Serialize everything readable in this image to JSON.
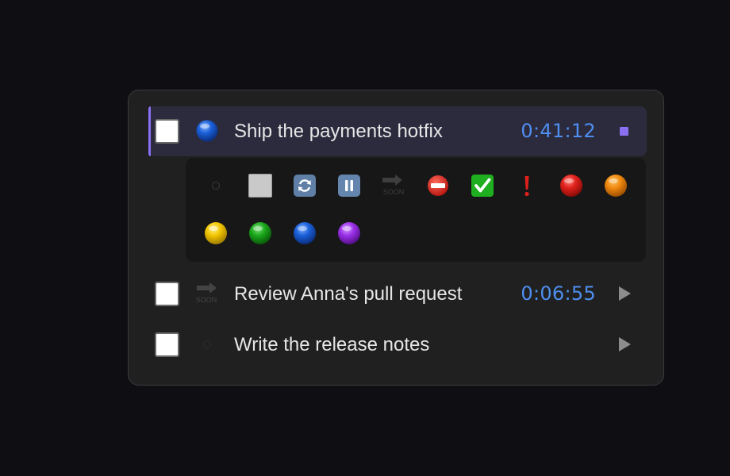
{
  "tasks": [
    {
      "title": "Ship the payments hotfix",
      "timer": "0:41:12",
      "status_icon": "blue-ball-icon",
      "action": "stop",
      "active": true,
      "checked": false
    },
    {
      "title": "Review Anna's pull request",
      "timer": "0:06:55",
      "status_icon": "soon-arrow-icon",
      "action": "play",
      "active": false,
      "checked": false
    },
    {
      "title": "Write the release notes",
      "timer": "",
      "status_icon": "empty-circle-icon",
      "action": "play",
      "active": false,
      "checked": false
    }
  ],
  "soon_label": "SOON",
  "status_picker": {
    "options": [
      "empty-circle-icon",
      "white-square-icon",
      "repeat-icon",
      "pause-icon",
      "soon-arrow-icon",
      "no-entry-icon",
      "check-mark-icon",
      "exclamation-icon",
      "red-ball-icon",
      "orange-ball-icon",
      "yellow-ball-icon",
      "green-ball-icon",
      "blue-ball-icon",
      "purple-ball-icon"
    ]
  },
  "colors": {
    "accent": "#8a6ff0",
    "timer": "#4e8ef0",
    "red": "#e0201c",
    "orange": "#f08a10",
    "yellow": "#f2c500",
    "green": "#1aa81a",
    "blue": "#1a5fd8",
    "purple": "#9b30e8"
  }
}
